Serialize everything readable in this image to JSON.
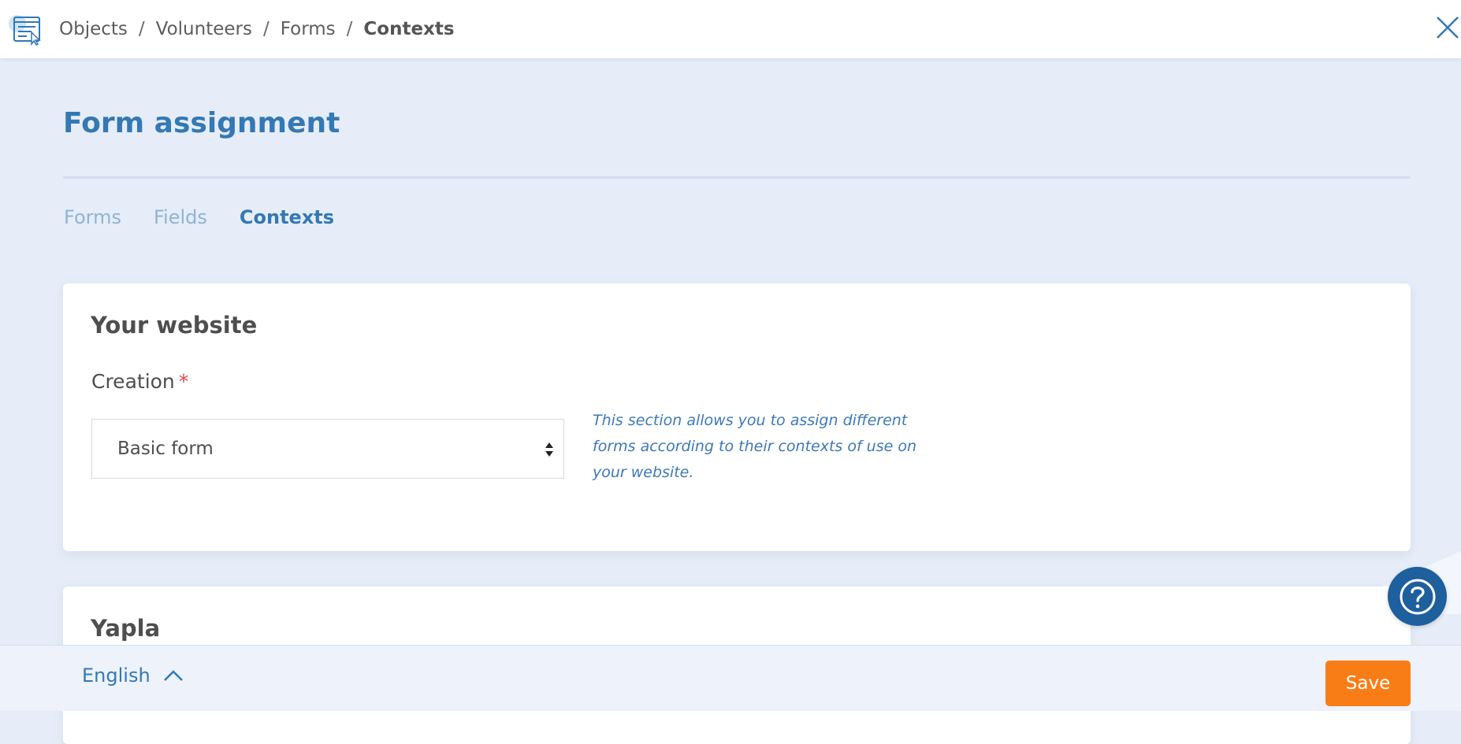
{
  "breadcrumb": {
    "items": [
      "Objects",
      "Volunteers",
      "Forms"
    ],
    "separator": "/",
    "current": "Contexts"
  },
  "page": {
    "title": "Form assignment"
  },
  "tabs": [
    {
      "label": "Forms",
      "active": false
    },
    {
      "label": "Fields",
      "active": false
    },
    {
      "label": "Contexts",
      "active": true
    }
  ],
  "sections": {
    "website": {
      "title": "Your website",
      "field_label": "Creation",
      "required_marker": "*",
      "selected_value": "Basic form",
      "help_text": "This section allows you to assign different forms according to their contexts of use on your website."
    },
    "yapla": {
      "title": "Yapla"
    }
  },
  "footer": {
    "language": "English",
    "save_label": "Save"
  },
  "icons": {
    "app": "form-list-icon",
    "close": "close-icon",
    "help": "help-question-icon",
    "select": "select-arrows-icon",
    "language_toggle": "chevron-up-icon"
  },
  "colors": {
    "accent": "#3478b4",
    "save": "#f97d16",
    "help_button": "#1e5f9e",
    "background": "#e6edf8",
    "required": "#e04848"
  }
}
